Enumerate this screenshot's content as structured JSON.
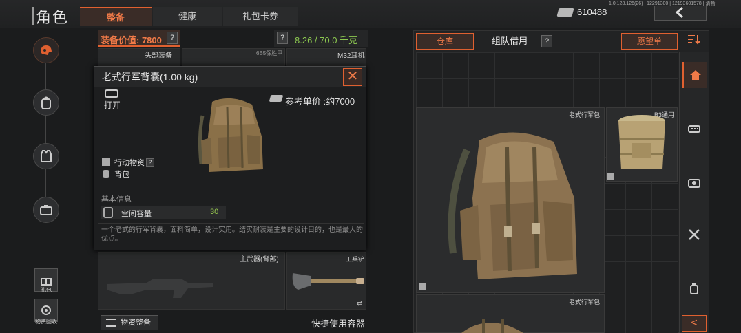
{
  "header": {
    "title": "角色",
    "tabs": [
      {
        "label": "整备",
        "active": true
      },
      {
        "label": "健康",
        "active": false
      },
      {
        "label": "礼包卡券",
        "active": false
      }
    ],
    "money": "610488",
    "version": "1.0.128.126(26) | 12291300 | 12193601578 | 清畅",
    "back_icon": "chevron-left-icon"
  },
  "left_rail": {
    "icons": [
      "helmet-icon",
      "backpack-icon",
      "vest-icon",
      "supply-box-icon"
    ],
    "gift_label": "礼包",
    "recycle_label": "物资回收"
  },
  "equipment": {
    "value_label": "装备价值: 7800",
    "help": "?",
    "weight": "8.26 / 70.0 千克",
    "slots": {
      "head": "头部装备",
      "armor": "6B5保胜甲",
      "ear": "M32耳机",
      "weapon": "主武器(背部)",
      "shovel": "工兵铲"
    },
    "organize_button": "物资整备",
    "quick_use": "快捷使用容器",
    "swap_icon": "⇄"
  },
  "popup": {
    "title": "老式行军背囊(1.00 kg)",
    "close_icon": "✕",
    "open_label": "打开",
    "price_label": "参考单价 :约7000",
    "tags": [
      "行动物资",
      "背包"
    ],
    "tag_help": "?",
    "basic_info": "基本信息",
    "capacity_label": "空间容量",
    "capacity_value": "30",
    "description": "一个老式的行军背囊，面料简单，设计实用。结实耐装是主要的设计目的，也是最大的优点。"
  },
  "storage": {
    "tabs": {
      "warehouse": "仓库",
      "team": "组队借用",
      "wishlist": "愿望单"
    },
    "help": "?",
    "sort_icon": "sort-icon",
    "items": [
      {
        "name": "老式行军包"
      },
      {
        "name": "B3通用"
      },
      {
        "name": "老式行军包"
      }
    ],
    "right_tabs": [
      "home-icon",
      "ammo-icon",
      "camera-icon",
      "tools-icon",
      "medicine-icon"
    ],
    "collapse_icon": "<"
  },
  "colors": {
    "accent": "#e06030",
    "positive": "#8cc850",
    "background": "#1b1c1d"
  }
}
